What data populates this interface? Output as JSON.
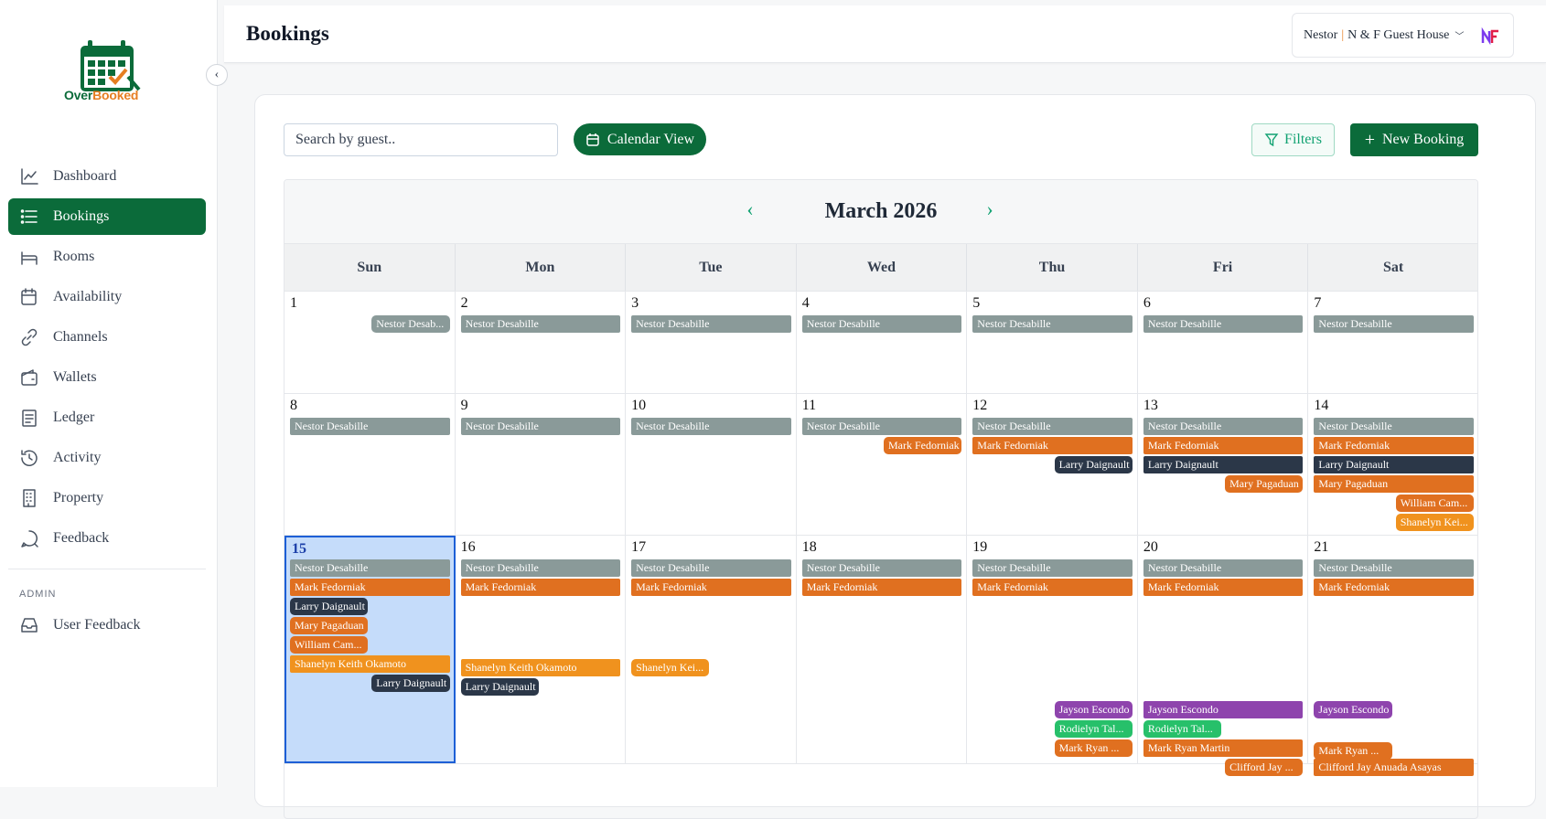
{
  "app": {
    "logo_part1": "Over",
    "logo_part2": "Booked"
  },
  "sidebar": {
    "items": [
      {
        "label": "Dashboard",
        "icon": "chart-line-icon"
      },
      {
        "label": "Bookings",
        "icon": "list-icon",
        "active": true
      },
      {
        "label": "Rooms",
        "icon": "bed-icon"
      },
      {
        "label": "Availability",
        "icon": "calendar-icon"
      },
      {
        "label": "Channels",
        "icon": "link-icon"
      },
      {
        "label": "Wallets",
        "icon": "wallet-icon"
      },
      {
        "label": "Ledger",
        "icon": "ledger-icon"
      },
      {
        "label": "Activity",
        "icon": "history-icon"
      },
      {
        "label": "Property",
        "icon": "building-icon"
      },
      {
        "label": "Feedback",
        "icon": "message-icon"
      }
    ],
    "admin_label": "ADMIN",
    "admin_items": [
      {
        "label": "User Feedback",
        "icon": "inbox-icon"
      }
    ]
  },
  "header": {
    "title": "Bookings",
    "user": "Nestor",
    "separator": "|",
    "property": "N & F Guest House"
  },
  "toolbar": {
    "search_placeholder": "Search by guest..",
    "calendar_view_label": "Calendar View",
    "filters_label": "Filters",
    "new_booking_label": "New Booking"
  },
  "colors": {
    "accent": "#0b6b3a",
    "gray": "#8a9a99",
    "orange": "#e07020",
    "navy": "#2b3748",
    "amber": "#f0921e",
    "purple": "#8e44ad",
    "green": "#27c06a"
  },
  "calendar": {
    "month_label": "March 2026",
    "days_of_week": [
      "Sun",
      "Mon",
      "Tue",
      "Wed",
      "Thu",
      "Fri",
      "Sat"
    ],
    "today": 15,
    "weeks": [
      {
        "days": [
          1,
          2,
          3,
          4,
          5,
          6,
          7
        ]
      },
      {
        "days": [
          8,
          9,
          10,
          11,
          12,
          13,
          14
        ]
      },
      {
        "days": [
          15,
          16,
          17,
          18,
          19,
          20,
          21
        ]
      }
    ],
    "events": [
      {
        "week": 0,
        "day": 0,
        "lane": 0,
        "span": 0.5,
        "offset": 0.5,
        "label": "Nestor Desab...",
        "color": "gray",
        "round": true
      },
      {
        "week": 0,
        "day": 1,
        "lane": 0,
        "label": "Nestor Desabille",
        "color": "gray"
      },
      {
        "week": 0,
        "day": 2,
        "lane": 0,
        "label": "Nestor Desabille",
        "color": "gray"
      },
      {
        "week": 0,
        "day": 3,
        "lane": 0,
        "label": "Nestor Desabille",
        "color": "gray"
      },
      {
        "week": 0,
        "day": 4,
        "lane": 0,
        "label": "Nestor Desabille",
        "color": "gray"
      },
      {
        "week": 0,
        "day": 5,
        "lane": 0,
        "label": "Nestor Desabille",
        "color": "gray"
      },
      {
        "week": 0,
        "day": 6,
        "lane": 0,
        "label": "Nestor Desabille",
        "color": "gray"
      },
      {
        "week": 1,
        "day": 0,
        "lane": 0,
        "label": "Nestor Desabille",
        "color": "gray"
      },
      {
        "week": 1,
        "day": 1,
        "lane": 0,
        "label": "Nestor Desabille",
        "color": "gray"
      },
      {
        "week": 1,
        "day": 2,
        "lane": 0,
        "label": "Nestor Desabille",
        "color": "gray"
      },
      {
        "week": 1,
        "day": 3,
        "lane": 0,
        "label": "Nestor Desabille",
        "color": "gray"
      },
      {
        "week": 1,
        "day": 4,
        "lane": 0,
        "label": "Nestor Desabille",
        "color": "gray"
      },
      {
        "week": 1,
        "day": 5,
        "lane": 0,
        "label": "Nestor Desabille",
        "color": "gray"
      },
      {
        "week": 1,
        "day": 6,
        "lane": 0,
        "label": "Nestor Desabille",
        "color": "gray"
      },
      {
        "week": 1,
        "day": 3,
        "lane": 1,
        "span": 0.5,
        "offset": 0.5,
        "label": "Mark Fedorniak",
        "color": "orange",
        "round": true
      },
      {
        "week": 1,
        "day": 4,
        "lane": 1,
        "label": "Mark Fedorniak",
        "color": "orange"
      },
      {
        "week": 1,
        "day": 5,
        "lane": 1,
        "label": "Mark Fedorniak",
        "color": "orange"
      },
      {
        "week": 1,
        "day": 6,
        "lane": 1,
        "label": "Mark Fedorniak",
        "color": "orange"
      },
      {
        "week": 1,
        "day": 4,
        "lane": 2,
        "span": 0.5,
        "offset": 0.5,
        "label": "Larry Daignault",
        "color": "navy",
        "round": true
      },
      {
        "week": 1,
        "day": 5,
        "lane": 2,
        "label": "Larry Daignault",
        "color": "navy"
      },
      {
        "week": 1,
        "day": 6,
        "lane": 2,
        "label": "Larry Daignault",
        "color": "navy"
      },
      {
        "week": 1,
        "day": 5,
        "lane": 3,
        "span": 0.5,
        "offset": 0.5,
        "label": "Mary Pagaduan",
        "color": "orange",
        "round": true
      },
      {
        "week": 1,
        "day": 6,
        "lane": 3,
        "label": "Mary Pagaduan",
        "color": "orange"
      },
      {
        "week": 1,
        "day": 6,
        "lane": 4,
        "span": 0.5,
        "offset": 0.5,
        "label": "William Cam...",
        "color": "orange",
        "round": true
      },
      {
        "week": 1,
        "day": 6,
        "lane": 5,
        "span": 0.5,
        "offset": 0.5,
        "label": "Shanelyn Kei...",
        "color": "amber",
        "round": true
      },
      {
        "week": 2,
        "day": 0,
        "lane": 0,
        "label": "Nestor Desabille",
        "color": "gray"
      },
      {
        "week": 2,
        "day": 1,
        "lane": 0,
        "label": "Nestor Desabille",
        "color": "gray"
      },
      {
        "week": 2,
        "day": 2,
        "lane": 0,
        "label": "Nestor Desabille",
        "color": "gray"
      },
      {
        "week": 2,
        "day": 3,
        "lane": 0,
        "label": "Nestor Desabille",
        "color": "gray"
      },
      {
        "week": 2,
        "day": 4,
        "lane": 0,
        "label": "Nestor Desabille",
        "color": "gray"
      },
      {
        "week": 2,
        "day": 5,
        "lane": 0,
        "label": "Nestor Desabille",
        "color": "gray"
      },
      {
        "week": 2,
        "day": 6,
        "lane": 0,
        "label": "Nestor Desabille",
        "color": "gray"
      },
      {
        "week": 2,
        "day": 0,
        "lane": 1,
        "label": "Mark Fedorniak",
        "color": "orange"
      },
      {
        "week": 2,
        "day": 1,
        "lane": 1,
        "label": "Mark Fedorniak",
        "color": "orange"
      },
      {
        "week": 2,
        "day": 2,
        "lane": 1,
        "label": "Mark Fedorniak",
        "color": "orange"
      },
      {
        "week": 2,
        "day": 3,
        "lane": 1,
        "label": "Mark Fedorniak",
        "color": "orange"
      },
      {
        "week": 2,
        "day": 4,
        "lane": 1,
        "label": "Mark Fedorniak",
        "color": "orange"
      },
      {
        "week": 2,
        "day": 5,
        "lane": 1,
        "label": "Mark Fedorniak",
        "color": "orange"
      },
      {
        "week": 2,
        "day": 6,
        "lane": 1,
        "label": "Mark Fedorniak",
        "color": "orange"
      },
      {
        "week": 2,
        "day": 0,
        "lane": 2,
        "span": 0.5,
        "label": "Larry Daignault",
        "color": "navy",
        "round": true
      },
      {
        "week": 2,
        "day": 0,
        "lane": 3,
        "span": 0.5,
        "label": "Mary Pagaduan",
        "color": "orange",
        "round": true
      },
      {
        "week": 2,
        "day": 0,
        "lane": 4,
        "span": 0.5,
        "label": "William Cam...",
        "color": "orange",
        "round": true
      },
      {
        "week": 2,
        "day": 0,
        "lane": 5,
        "label": "Shanelyn Keith Okamoto",
        "color": "amber"
      },
      {
        "week": 2,
        "day": 0,
        "lane": 6,
        "span": 0.5,
        "offset": 0.5,
        "label": "Larry Daignault",
        "color": "navy",
        "round": true
      },
      {
        "week": 2,
        "day": 1,
        "lane": 5.2,
        "label": "Shanelyn Keith Okamoto",
        "color": "amber"
      },
      {
        "week": 2,
        "day": 1,
        "lane": 6.2,
        "span": 0.5,
        "label": "Larry Daignault",
        "color": "navy",
        "round": true
      },
      {
        "week": 2,
        "day": 2,
        "lane": 5.2,
        "span": 0.5,
        "label": "Shanelyn Kei...",
        "color": "amber",
        "round": true
      },
      {
        "week": 2,
        "day": 4,
        "lane": 7.4,
        "span": 0.5,
        "offset": 0.5,
        "label": "Jayson Escondo",
        "color": "purple",
        "round": true
      },
      {
        "week": 2,
        "day": 5,
        "lane": 7.4,
        "label": "Jayson Escondo",
        "color": "purple"
      },
      {
        "week": 2,
        "day": 6,
        "lane": 7.4,
        "span": 0.5,
        "label": "Jayson Escondo",
        "color": "purple",
        "round": true
      },
      {
        "week": 2,
        "day": 4,
        "lane": 8.4,
        "span": 0.5,
        "offset": 0.5,
        "label": "Rodielyn Tal...",
        "color": "green",
        "round": true
      },
      {
        "week": 2,
        "day": 5,
        "lane": 8.4,
        "span": 0.5,
        "label": "Rodielyn Tal...",
        "color": "green",
        "round": true
      },
      {
        "week": 2,
        "day": 4,
        "lane": 9.4,
        "span": 0.5,
        "offset": 0.5,
        "label": "Mark Ryan ...",
        "color": "orange",
        "round": true
      },
      {
        "week": 2,
        "day": 5,
        "lane": 9.4,
        "label": "Mark Ryan Martin",
        "color": "orange"
      },
      {
        "week": 2,
        "day": 6,
        "lane": 9.5,
        "span": 0.5,
        "label": "Mark Ryan ...",
        "color": "orange",
        "round": true
      },
      {
        "week": 2,
        "day": 5,
        "lane": 10.4,
        "span": 0.5,
        "offset": 0.5,
        "label": "Clifford Jay ...",
        "color": "orange",
        "round": true
      },
      {
        "week": 2,
        "day": 6,
        "lane": 10.4,
        "label": "Clifford Jay Anuada Asayas",
        "color": "orange"
      }
    ]
  }
}
